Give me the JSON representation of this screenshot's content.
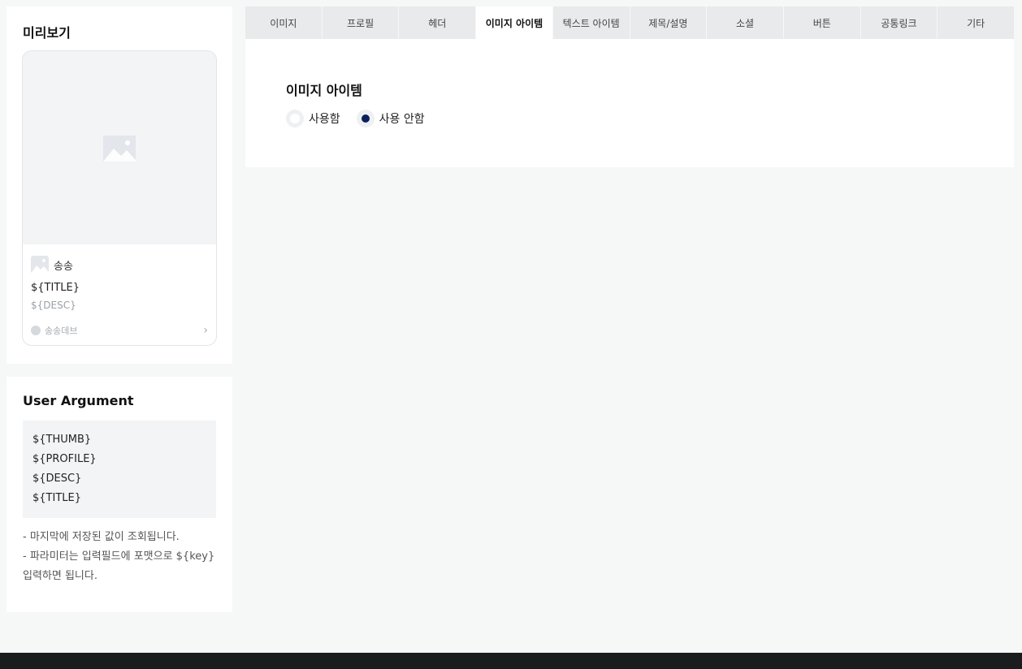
{
  "preview": {
    "title": "미리보기",
    "card": {
      "profile_name": "송송",
      "title": "${TITLE}",
      "desc": "${DESC}",
      "brand_name": "송송데브"
    }
  },
  "user_argument": {
    "title": "User Argument",
    "args": [
      "${THUMB}",
      "${PROFILE}",
      "${DESC}",
      "${TITLE}"
    ],
    "notes": [
      "- 마지막에 저장된 값이 조회됩니다.",
      "- 파라미터는 입력필드에 포맷으로 ${key} 입력하면 됩니다."
    ]
  },
  "tabs": [
    {
      "label": "이미지"
    },
    {
      "label": "프로필"
    },
    {
      "label": "헤더"
    },
    {
      "label": "이미지 아이템",
      "active": true
    },
    {
      "label": "텍스트 아이템"
    },
    {
      "label": "제목/설명"
    },
    {
      "label": "소셜"
    },
    {
      "label": "버튼"
    },
    {
      "label": "공통링크"
    },
    {
      "label": "기타"
    }
  ],
  "section": {
    "title": "이미지 아이템",
    "options": [
      {
        "label": "사용함",
        "selected": false
      },
      {
        "label": "사용 안함",
        "selected": true
      }
    ]
  },
  "colors": {
    "radio_selected": "#0b1f5c",
    "footer": "#1b1c1d"
  }
}
